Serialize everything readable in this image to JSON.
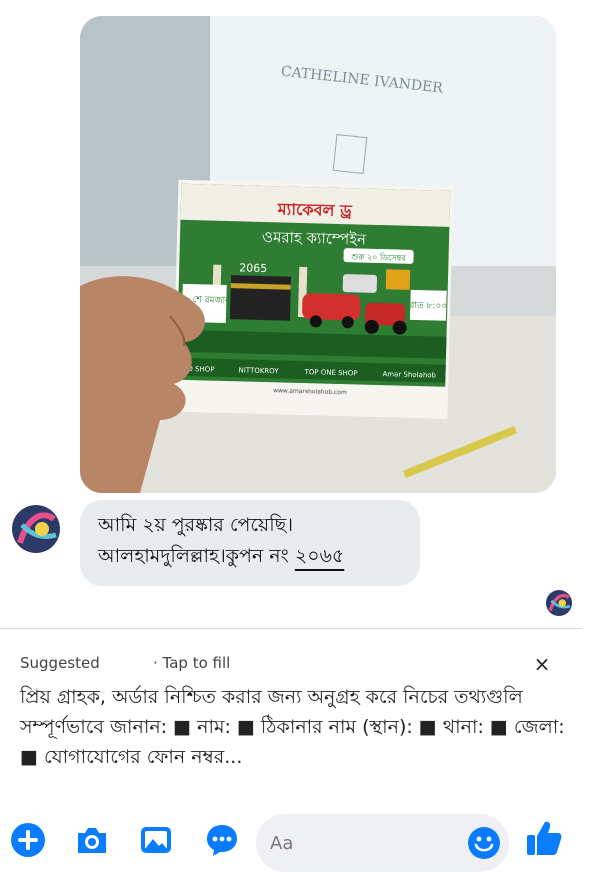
{
  "photo": {
    "card_header": "ম্যাকেবল ড্র",
    "card_title": "ওমরাহ ক্যাম্পেইন",
    "card_start": "শুরু ২০ ডিসেম্বর",
    "card_year": "2065",
    "card_date": "২৮ শে রমজান",
    "card_time": "রাত ৮:০০",
    "card_social": [
      "RD SHOP",
      "NITTOKROY",
      "TOP ONE SHOP",
      "Amar Sholahob"
    ],
    "card_url": "www.amarsholahob.com",
    "monitor_names": "CATHELINE IVANDER"
  },
  "message": {
    "line1": "আমি ২য় পুরষ্কার পেয়েছি।",
    "line2_prefix": "আলহামদুলিল্লাহ।কুপন নং ",
    "coupon": "২০৬৫"
  },
  "suggestion": {
    "label": "Suggested",
    "tap": "· Tap to fill",
    "close": "×",
    "text": "প্রিয় গ্রাহক, অর্ডার নিশ্চিত করার জন্য অনুগ্রহ করে নিচের তথ্যগুলি সম্পূর্ণভাবে জানান: ■ নাম: ■ ঠিকানার নাম (স্থান): ■ থানা: ■ জেলা: ■ যোগাযোগের ফোন নম্বর..."
  },
  "composer": {
    "placeholder": "Aa",
    "icons": [
      "plus-icon",
      "camera-icon",
      "gallery-icon",
      "chat-bubble-icon",
      "emoji-icon",
      "thumbs-up-icon"
    ],
    "accent": "#0a7cff"
  }
}
